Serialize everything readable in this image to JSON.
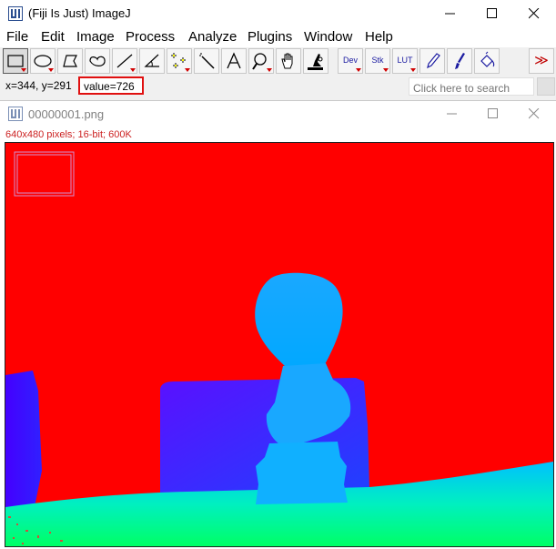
{
  "app": {
    "title": "(Fiji Is Just) ImageJ"
  },
  "menu": [
    "File",
    "Edit",
    "Image",
    "Process",
    "Analyze",
    "Plugins",
    "Window",
    "Help"
  ],
  "toolbar": {
    "active_tool": "rectangle",
    "dev_label": "Dev",
    "stk_label": "Stk",
    "lut_label": "LUT",
    "more_symbol": "≫"
  },
  "status": {
    "coords": "x=344, y=291",
    "value": "value=726",
    "search_placeholder": "Click here to search"
  },
  "image_window": {
    "title": "00000001.png",
    "info": "640x480 pixels; 16-bit; 600K"
  },
  "colors": {
    "highlight_box": "#e01010",
    "background_depth": "#ff0000",
    "near_depth": "#00ff88"
  }
}
